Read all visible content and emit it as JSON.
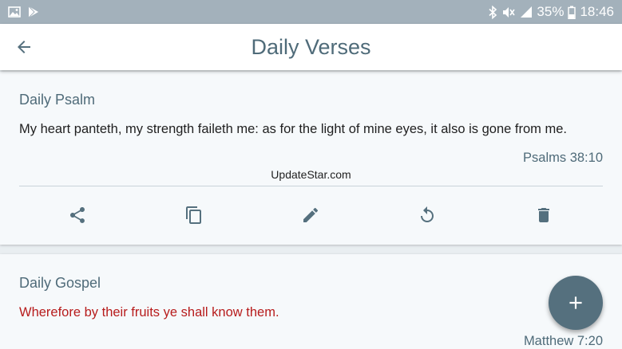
{
  "status_bar": {
    "battery_percent": "35%",
    "time": "18:46",
    "icons": [
      "image-icon",
      "play-store-icon",
      "bluetooth-icon",
      "mute-icon",
      "signal-icon",
      "battery-icon"
    ]
  },
  "app_bar": {
    "title": "Daily Verses",
    "back_icon": "arrow-back-icon"
  },
  "cards": [
    {
      "title": "Daily Psalm",
      "text": "My heart panteth, my strength faileth me: as for the light of mine eyes, it also is gone from me.",
      "reference": "Psalms 38:10",
      "watermark": "UpdateStar.com",
      "actions": [
        "share-icon",
        "copy-icon",
        "edit-icon",
        "refresh-icon",
        "delete-icon"
      ]
    },
    {
      "title": "Daily Gospel",
      "text": "Wherefore by their fruits ye shall know them.",
      "reference": "Matthew 7:20"
    }
  ],
  "fab": {
    "icon": "plus-icon"
  },
  "colors": {
    "status_bar": "#a3b1bb",
    "accent": "#4f6b79",
    "fab": "#55707e",
    "gospel_text": "#b71c1c",
    "background": "#e9eef1"
  }
}
